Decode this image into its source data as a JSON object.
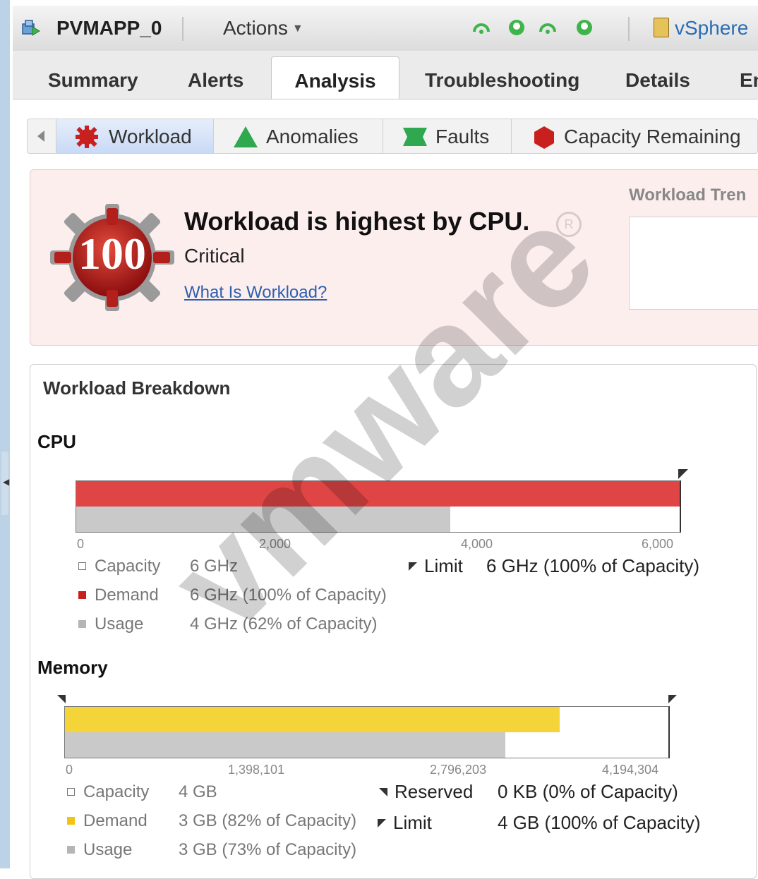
{
  "header": {
    "object_name": "PVMAPP_0",
    "actions_label": "Actions",
    "vsphere_label": "vSphere"
  },
  "tabs": [
    "Summary",
    "Alerts",
    "Analysis",
    "Troubleshooting",
    "Details",
    "En"
  ],
  "active_tab": "Analysis",
  "subtabs": [
    "Workload",
    "Anomalies",
    "Faults",
    "Capacity Remaining"
  ],
  "active_subtab": "Workload",
  "alert": {
    "badge_value": "100",
    "title": "Workload is highest by CPU.",
    "severity": "Critical",
    "link": "What Is Workload?",
    "trend_label": "Workload Tren"
  },
  "breakdown": {
    "title": "Workload Breakdown",
    "cpu": {
      "title": "CPU",
      "axis_max": 6000,
      "ticks": [
        "0",
        "2,000",
        "4,000",
        "6,000"
      ],
      "demand_fraction": 1.0,
      "usage_fraction": 0.62,
      "legend": [
        {
          "label": "Capacity",
          "value": "6 GHz"
        },
        {
          "label": "Demand",
          "value": "6 GHz (100% of Capacity)"
        },
        {
          "label": "Usage",
          "value": "4 GHz (62% of Capacity)"
        }
      ],
      "limit": {
        "label": "Limit",
        "value": "6 GHz (100% of Capacity)"
      }
    },
    "memory": {
      "title": "Memory",
      "ticks": [
        "0",
        "1,398,101",
        "2,796,203",
        "4,194,304"
      ],
      "demand_fraction": 0.82,
      "usage_fraction": 0.73,
      "legend": [
        {
          "label": "Capacity",
          "value": "4 GB"
        },
        {
          "label": "Demand",
          "value": "3 GB (82% of Capacity)"
        },
        {
          "label": "Usage",
          "value": "3 GB (73% of Capacity)"
        }
      ],
      "reserved": {
        "label": "Reserved",
        "value": "0 KB (0% of Capacity)"
      },
      "limit": {
        "label": "Limit",
        "value": "4 GB (100% of Capacity)"
      }
    }
  },
  "colors": {
    "demand_cpu": "#e04545",
    "demand_memory": "#f5d43a",
    "usage": "#c9c9c9",
    "status_green": "#3db54a",
    "critical_red": "#c8201e"
  },
  "icons": [
    "vm-icon",
    "actions-caret-icon",
    "status-icon",
    "vsphere-doc-icon",
    "workload-gear-icon",
    "anomalies-triangle-icon",
    "faults-icon",
    "capacity-hexagon-icon"
  ],
  "watermark": "vmware"
}
